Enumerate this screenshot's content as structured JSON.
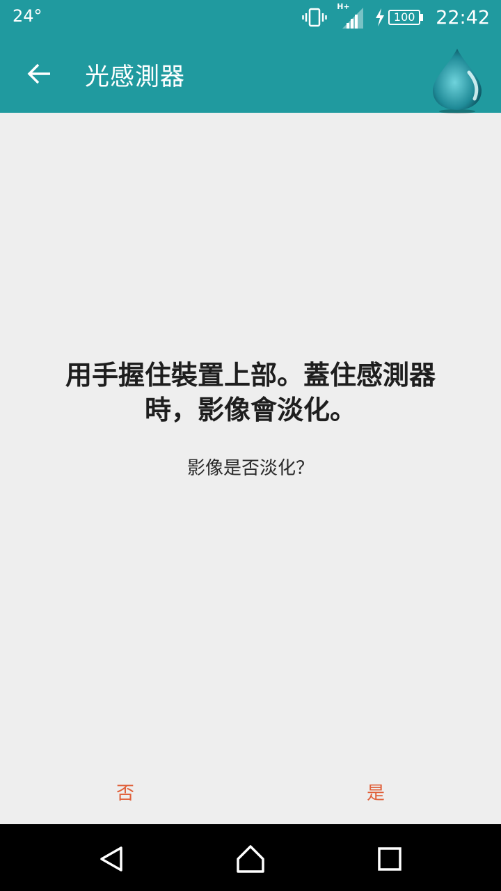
{
  "status_bar": {
    "temperature": "24°",
    "network": "H+",
    "battery": "100",
    "time": "22:42"
  },
  "app_bar": {
    "title": "光感測器",
    "back_icon": "arrow-left-icon",
    "app_icon": "water-drop-icon",
    "color": "#209A9F"
  },
  "content": {
    "instruction_line1": "用手握住裝置上部。蓋住感測器",
    "instruction_line2": "時，影像會淡化。",
    "question": "影像是否淡化？"
  },
  "actions": {
    "no_label": "否",
    "yes_label": "是",
    "accent": "#E0603A"
  },
  "nav_bar": {
    "back_icon": "triangle-back-icon",
    "home_icon": "home-icon",
    "recent_icon": "square-recent-icon"
  }
}
